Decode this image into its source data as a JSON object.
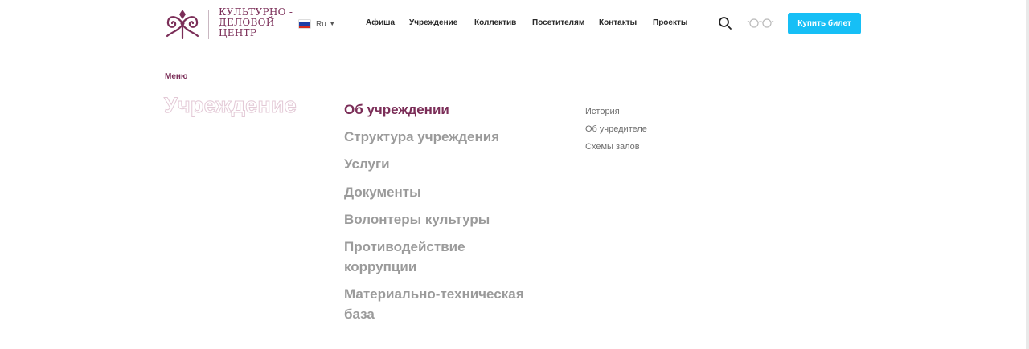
{
  "colors": {
    "brand": "#7b2e58",
    "accent": "#16bff6",
    "muted": "#9b9b9b"
  },
  "logo": {
    "line1": "КУЛЬТУРНО -",
    "line2": "ДЕЛОВОЙ",
    "line3": "ЦЕНТР",
    "icon": "ornament-emblem"
  },
  "language": {
    "label": "Ru",
    "flag": "russia-flag-icon"
  },
  "nav": {
    "items": [
      {
        "label": "Афиша"
      },
      {
        "label": "Учреждение",
        "active": true
      },
      {
        "label": "Коллектив"
      },
      {
        "label": "Посетителям"
      },
      {
        "label": "Контакты"
      },
      {
        "label": "Проекты"
      }
    ]
  },
  "header": {
    "buy_label": "Купить билет",
    "search_icon": "search-icon",
    "accessibility_icon": "glasses-icon"
  },
  "menu": {
    "breadcrumb": "Меню",
    "title": "Учреждение",
    "items": [
      {
        "label": "Об учреждении",
        "active": true
      },
      {
        "label": "Структура учреждения"
      },
      {
        "label": "Услуги"
      },
      {
        "label": "Документы"
      },
      {
        "label": "Волонтеры культуры"
      },
      {
        "label": "Противодействие коррупции"
      },
      {
        "label": "Материально-техническая база"
      }
    ],
    "subitems": [
      {
        "label": "История"
      },
      {
        "label": "Об учредителе"
      },
      {
        "label": "Схемы залов"
      }
    ]
  }
}
